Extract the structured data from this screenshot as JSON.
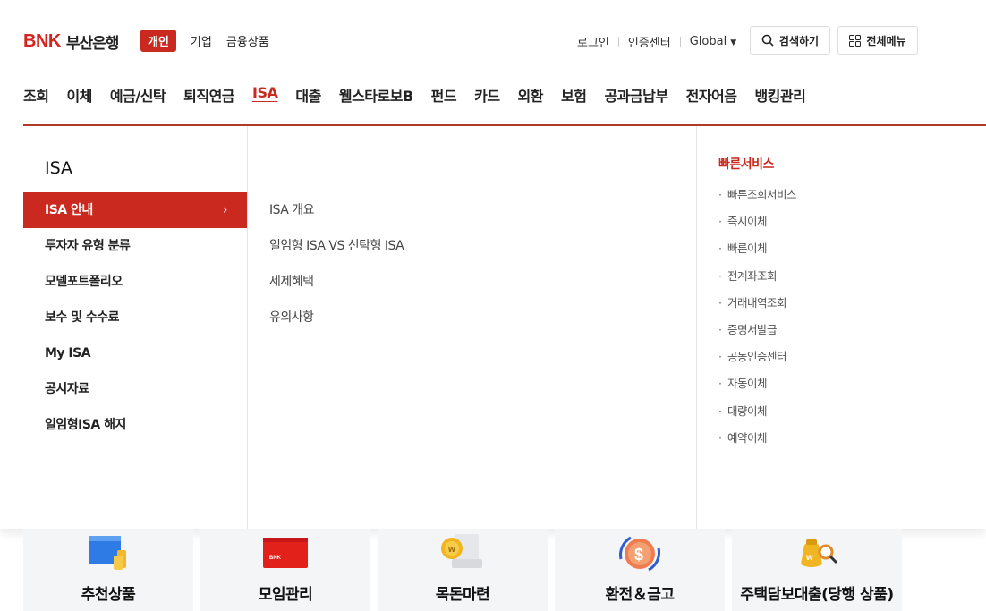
{
  "header": {
    "logo_mark": "BNK",
    "logo_name": "부산은행",
    "segments": [
      "개인",
      "기업",
      "금융상품"
    ],
    "util": {
      "login": "로그인",
      "cert": "인증센터",
      "global": "Global"
    },
    "search_label": "검색하기",
    "menu_label": "전체메뉴"
  },
  "gnb": [
    "조회",
    "이체",
    "예금/신탁",
    "퇴직연금",
    "ISA",
    "대출",
    "웰스타로보B",
    "펀드",
    "카드",
    "외환",
    "보험",
    "공과금납부",
    "전자어음",
    "뱅킹관리"
  ],
  "panel": {
    "title": "ISA",
    "lnb": [
      "ISA 안내",
      "투자자 유형 분류",
      "모델포트폴리오",
      "보수 및 수수료",
      "My ISA",
      "공시자료",
      "일임형ISA 해지"
    ],
    "sub": [
      "ISA 개요",
      "일임형 ISA VS 신탁형 ISA",
      "세제혜택",
      "유의사항"
    ],
    "quick_title": "빠른서비스",
    "quick": [
      "빠른조회서비스",
      "즉시이체",
      "빠른이체",
      "전계좌조회",
      "거래내역조회",
      "증명서발급",
      "공동인증센터",
      "자동이체",
      "대량이체",
      "예약이체"
    ]
  },
  "cards": [
    "추천상품",
    "모임관리",
    "목돈마련",
    "환전＆금고",
    "주택담보대출(당행 상품)"
  ],
  "colors": {
    "accent": "#c9291e"
  }
}
